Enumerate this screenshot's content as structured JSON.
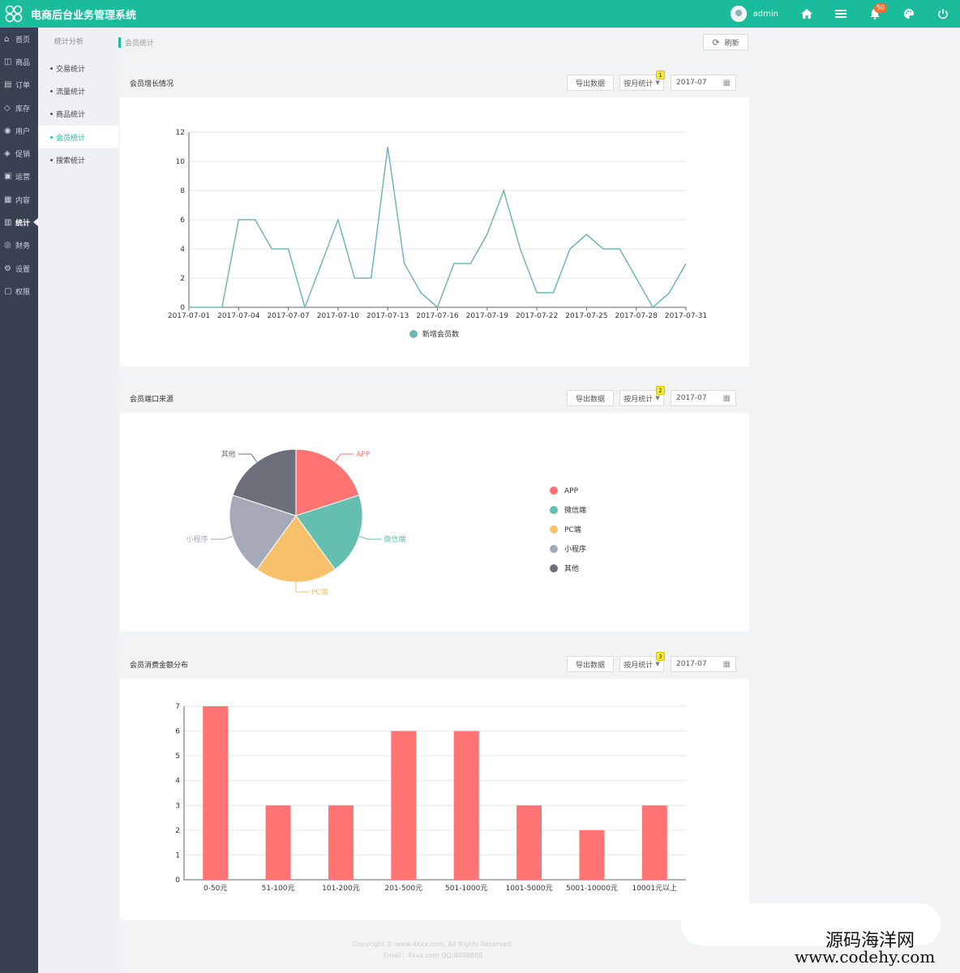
{
  "app": {
    "title": "电商后台业务管理系统",
    "user": "admin",
    "notification_count": "50"
  },
  "sidebar": {
    "items": [
      {
        "label": "首页",
        "icon": "home-icon",
        "glyph": "⌂"
      },
      {
        "label": "商品",
        "icon": "product-icon",
        "glyph": "◫"
      },
      {
        "label": "订单",
        "icon": "order-icon",
        "glyph": "▤"
      },
      {
        "label": "库存",
        "icon": "stock-icon",
        "glyph": "◇"
      },
      {
        "label": "用户",
        "icon": "user-icon",
        "glyph": "◉"
      },
      {
        "label": "促销",
        "icon": "tag-icon",
        "glyph": "◈"
      },
      {
        "label": "运营",
        "icon": "operate-icon",
        "glyph": "▣"
      },
      {
        "label": "内容",
        "icon": "content-icon",
        "glyph": "▦"
      },
      {
        "label": "统计",
        "icon": "stats-icon",
        "glyph": "▥",
        "active": true
      },
      {
        "label": "财务",
        "icon": "finance-icon",
        "glyph": "◎"
      },
      {
        "label": "设置",
        "icon": "settings-icon",
        "glyph": "⚙"
      },
      {
        "label": "权限",
        "icon": "permission-icon",
        "glyph": "▢"
      }
    ]
  },
  "subnav": {
    "title": "统计分析",
    "items": [
      {
        "label": "交易统计"
      },
      {
        "label": "流量统计"
      },
      {
        "label": "商品统计"
      },
      {
        "label": "会员统计",
        "active": true
      },
      {
        "label": "搜索统计"
      }
    ]
  },
  "breadcrumb": "会员统计",
  "refresh_label": "刷新",
  "panels": [
    {
      "title": "会员增长情况",
      "export": "导出数据",
      "select": "按月统计",
      "date": "2017-07",
      "badge": "1"
    },
    {
      "title": "会员端口来源",
      "export": "导出数据",
      "select": "按月统计",
      "date": "2017-07",
      "badge": "2"
    },
    {
      "title": "会员消费金额分布",
      "export": "导出数据",
      "select": "按月统计",
      "date": "2017-07",
      "badge": "3"
    }
  ],
  "colors": {
    "accent": "#1abc9c",
    "sidebar": "#3a3f51",
    "line": "#6fb7b7",
    "bar": "#ff7b7b"
  },
  "chart_data": [
    {
      "type": "line",
      "x": [
        "2017-07-01",
        "2017-07-02",
        "2017-07-03",
        "2017-07-04",
        "2017-07-05",
        "2017-07-06",
        "2017-07-07",
        "2017-07-08",
        "2017-07-09",
        "2017-07-10",
        "2017-07-11",
        "2017-07-12",
        "2017-07-13",
        "2017-07-14",
        "2017-07-15",
        "2017-07-16",
        "2017-07-17",
        "2017-07-18",
        "2017-07-19",
        "2017-07-20",
        "2017-07-21",
        "2017-07-22",
        "2017-07-23",
        "2017-07-24",
        "2017-07-25",
        "2017-07-26",
        "2017-07-27",
        "2017-07-28",
        "2017-07-29",
        "2017-07-30",
        "2017-07-31"
      ],
      "xticks": [
        "2017-07-01",
        "2017-07-04",
        "2017-07-07",
        "2017-07-10",
        "2017-07-13",
        "2017-07-16",
        "2017-07-19",
        "2017-07-22",
        "2017-07-25",
        "2017-07-28",
        "2017-07-31"
      ],
      "series": [
        {
          "name": "新增会员数",
          "color": "#6fb7b7",
          "values": [
            0,
            0,
            0,
            6,
            6,
            4,
            4,
            0,
            3,
            6,
            2,
            2,
            11,
            3,
            1,
            0,
            3,
            3,
            5,
            8,
            4,
            1,
            1,
            4,
            5,
            4,
            4,
            2,
            0,
            1,
            3
          ]
        }
      ],
      "ylim": [
        0,
        12
      ],
      "yticks": [
        "0",
        "2",
        "4",
        "6",
        "8",
        "10",
        "12"
      ],
      "legend": "bottom",
      "grid": true
    },
    {
      "type": "pie",
      "slices": [
        {
          "label": "APP",
          "value": 20,
          "color": "#ff7373"
        },
        {
          "label": "微信端",
          "value": 20,
          "color": "#64bfb1"
        },
        {
          "label": "PC端",
          "value": 20,
          "color": "#f7c06a"
        },
        {
          "label": "小程序",
          "value": 20,
          "color": "#a6a9b8"
        },
        {
          "label": "其他",
          "value": 20,
          "color": "#6d6f7b"
        }
      ],
      "legend": "right"
    },
    {
      "type": "bar",
      "categories": [
        "0-50元",
        "51-100元",
        "101-200元",
        "201-500元",
        "501-1000元",
        "1001-5000元",
        "5001-10000元",
        "10001元以上"
      ],
      "values": [
        7,
        3,
        3,
        6,
        6,
        3,
        2,
        3
      ],
      "ylim": [
        0,
        7
      ],
      "yticks": [
        "0",
        "1",
        "2",
        "3",
        "4",
        "5",
        "6",
        "7"
      ],
      "color": "#ff7373",
      "grid": true
    }
  ],
  "footer": {
    "line1": "Copyright © www.4xxx.com, All Rights Reserved.",
    "line2": "Email：4xxx.com  QQ:8888888"
  },
  "watermark": {
    "line1": "源码海洋网",
    "line2": "www.codehy.com"
  }
}
